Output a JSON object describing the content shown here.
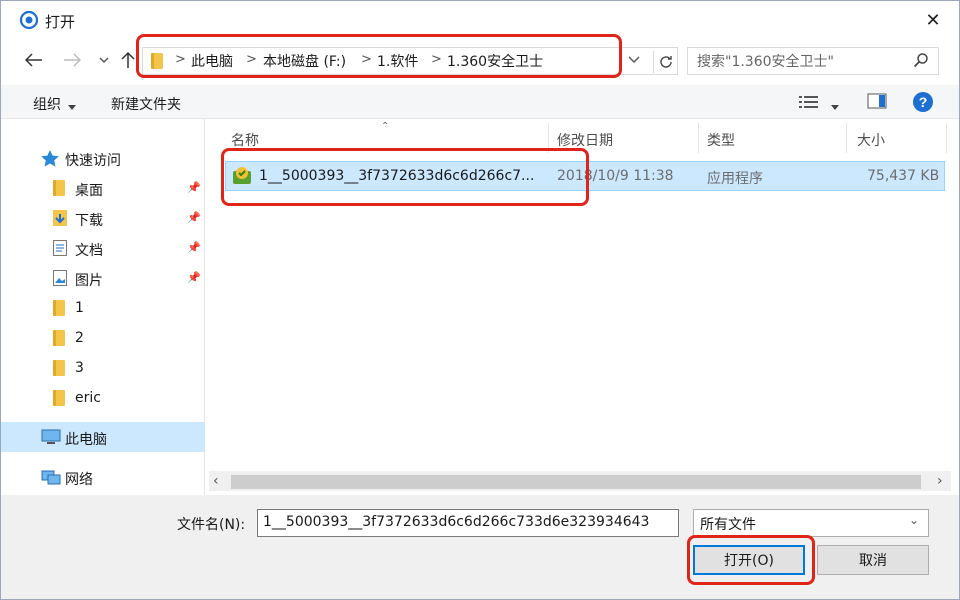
{
  "window": {
    "title": "打开",
    "title_icon": "app-globe-icon",
    "close": "✕"
  },
  "nav": {
    "back": "back-arrow-icon",
    "forward": "forward-arrow-icon",
    "recent": "chevron-down-icon",
    "up": "up-arrow-icon"
  },
  "address": {
    "segments": [
      "此电脑",
      "本地磁盘 (F:)",
      "1.软件",
      "1.360安全卫士"
    ],
    "separator": ">"
  },
  "search": {
    "placeholder": "搜索\"1.360安全卫士\""
  },
  "toolbar": {
    "organize": "组织",
    "new_folder": "新建文件夹"
  },
  "sidebar": {
    "items": [
      {
        "label": "快速访问",
        "icon": "star-icon"
      },
      {
        "label": "桌面",
        "icon": "folder-icon",
        "pinned": true
      },
      {
        "label": "下载",
        "icon": "download-folder-icon",
        "pinned": true
      },
      {
        "label": "文档",
        "icon": "documents-icon",
        "pinned": true
      },
      {
        "label": "图片",
        "icon": "pictures-icon",
        "pinned": true
      },
      {
        "label": "1",
        "icon": "folder-icon"
      },
      {
        "label": "2",
        "icon": "folder-icon"
      },
      {
        "label": "3",
        "icon": "folder-icon"
      },
      {
        "label": "eric",
        "icon": "folder-icon"
      },
      {
        "label": "此电脑",
        "icon": "computer-icon",
        "selected": true
      },
      {
        "label": "网络",
        "icon": "network-icon"
      }
    ]
  },
  "columns": {
    "name": "名称",
    "date": "修改日期",
    "type": "类型",
    "size": "大小"
  },
  "files": [
    {
      "name": "1__5000393__3f7372633d6c6d266c7...",
      "date": "2018/10/9 11:38",
      "type": "应用程序",
      "size": "75,437 KB",
      "selected": true
    }
  ],
  "footer": {
    "filename_label": "文件名(N):",
    "filename_value": "1__5000393__3f7372633d6c6d266c733d6e323934643",
    "filetype": "所有文件",
    "open": "打开(O)",
    "cancel": "取消"
  },
  "colors": {
    "highlight": "#e0241a",
    "selection": "#cce8ff",
    "accent": "#0078d7"
  }
}
